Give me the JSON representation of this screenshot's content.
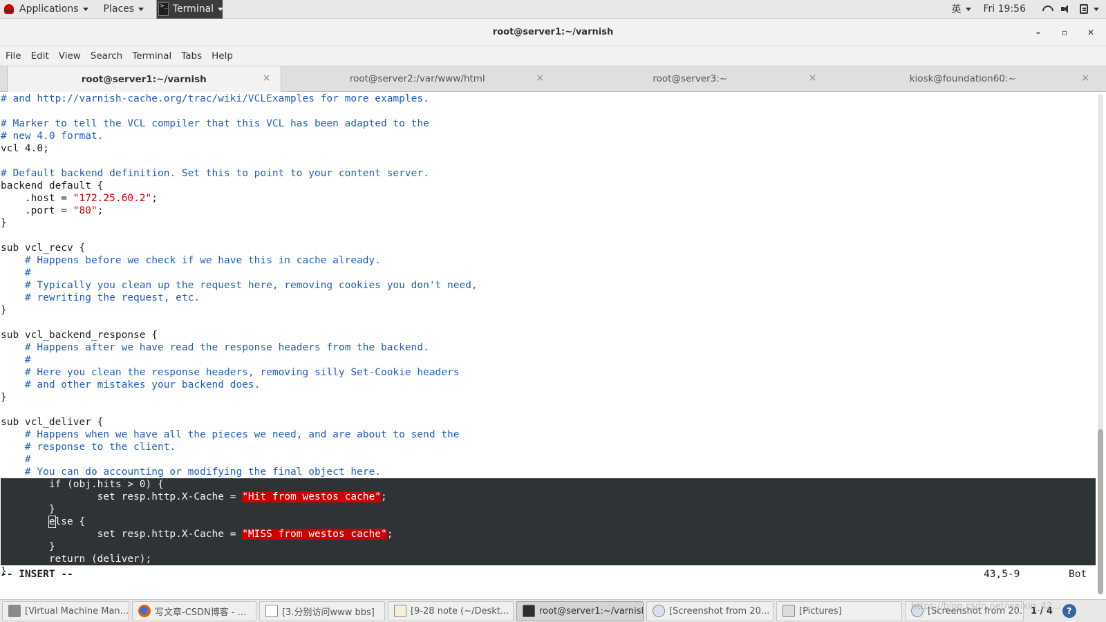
{
  "top_panel": {
    "applications_label": "Applications",
    "places_label": "Places",
    "terminal_label": "Terminal",
    "input_method": "英",
    "clock": "Fri 19:56"
  },
  "window": {
    "title": "root@server1:~/varnish",
    "minimize": "–",
    "maximize": "▫",
    "close": "✕"
  },
  "menu": [
    "File",
    "Edit",
    "View",
    "Search",
    "Terminal",
    "Tabs",
    "Help"
  ],
  "tabs": [
    {
      "label": "root@server1:~/varnish",
      "active": true
    },
    {
      "label": "root@server2:/var/www/html",
      "active": false
    },
    {
      "label": "root@server3:~",
      "active": false
    },
    {
      "label": "kiosk@foundation60:~",
      "active": false
    }
  ],
  "tab_close_glyph": "×",
  "code_lines": [
    {
      "segs": [
        [
          "c",
          "# and http://varnish-cache.org/trac/wiki/VCLExamples for more examples."
        ]
      ]
    },
    {
      "segs": []
    },
    {
      "segs": [
        [
          "c",
          "# Marker to tell the VCL compiler that this VCL has been adapted to the"
        ]
      ]
    },
    {
      "segs": [
        [
          "c",
          "# new 4.0 format."
        ]
      ]
    },
    {
      "segs": [
        [
          "n",
          "vcl 4.0;"
        ]
      ]
    },
    {
      "segs": []
    },
    {
      "segs": [
        [
          "c",
          "# Default backend definition. Set this to point to your content server."
        ]
      ]
    },
    {
      "segs": [
        [
          "n",
          "backend default {"
        ]
      ]
    },
    {
      "segs": [
        [
          "n",
          "    .host = "
        ],
        [
          "s",
          "\"172.25.60.2\""
        ],
        [
          "n",
          ";"
        ]
      ]
    },
    {
      "segs": [
        [
          "n",
          "    .port = "
        ],
        [
          "s",
          "\"80\""
        ],
        [
          "n",
          ";"
        ]
      ]
    },
    {
      "segs": [
        [
          "n",
          "}"
        ]
      ]
    },
    {
      "segs": []
    },
    {
      "segs": [
        [
          "n",
          "sub vcl_recv {"
        ]
      ]
    },
    {
      "segs": [
        [
          "n",
          "    "
        ],
        [
          "c",
          "# Happens before we check if we have this in cache already."
        ]
      ]
    },
    {
      "segs": [
        [
          "n",
          "    "
        ],
        [
          "c",
          "#"
        ]
      ]
    },
    {
      "segs": [
        [
          "n",
          "    "
        ],
        [
          "c",
          "# Typically you clean up the request here, removing cookies you don't need,"
        ]
      ]
    },
    {
      "segs": [
        [
          "n",
          "    "
        ],
        [
          "c",
          "# rewriting the request, etc."
        ]
      ]
    },
    {
      "segs": [
        [
          "n",
          "}"
        ]
      ]
    },
    {
      "segs": []
    },
    {
      "segs": [
        [
          "n",
          "sub vcl_backend_response {"
        ]
      ]
    },
    {
      "segs": [
        [
          "n",
          "    "
        ],
        [
          "c",
          "# Happens after we have read the response headers from the backend."
        ]
      ]
    },
    {
      "segs": [
        [
          "n",
          "    "
        ],
        [
          "c",
          "#"
        ]
      ]
    },
    {
      "segs": [
        [
          "n",
          "    "
        ],
        [
          "c",
          "# Here you clean the response headers, removing silly Set-Cookie headers"
        ]
      ]
    },
    {
      "segs": [
        [
          "n",
          "    "
        ],
        [
          "c",
          "# and other mistakes your backend does."
        ]
      ]
    },
    {
      "segs": [
        [
          "n",
          "}"
        ]
      ]
    },
    {
      "segs": []
    },
    {
      "segs": [
        [
          "n",
          "sub vcl_deliver {"
        ]
      ]
    },
    {
      "segs": [
        [
          "n",
          "    "
        ],
        [
          "c",
          "# Happens when we have all the pieces we need, and are about to send the"
        ]
      ]
    },
    {
      "segs": [
        [
          "n",
          "    "
        ],
        [
          "c",
          "# response to the client."
        ]
      ]
    },
    {
      "segs": [
        [
          "n",
          "    "
        ],
        [
          "c",
          "#"
        ]
      ]
    },
    {
      "segs": [
        [
          "n",
          "    "
        ],
        [
          "c",
          "# You can do accounting or modifying the final object here."
        ]
      ]
    },
    {
      "hl": true,
      "segs": [
        [
          "n",
          "        if (obj.hits > 0) {"
        ]
      ]
    },
    {
      "hl": true,
      "segs": [
        [
          "n",
          "                set resp.http.X-Cache = "
        ],
        [
          "sb",
          "\"Hit from westos cache\""
        ],
        [
          "n",
          ";"
        ]
      ]
    },
    {
      "hl": true,
      "segs": [
        [
          "n",
          "        }"
        ]
      ]
    },
    {
      "hl": true,
      "segs": [
        [
          "n",
          "        "
        ],
        [
          "cur",
          "e"
        ],
        [
          "n",
          "lse {"
        ]
      ]
    },
    {
      "hl": true,
      "segs": [
        [
          "n",
          "                set resp.http.X-Cache = "
        ],
        [
          "sb",
          "\"MISS from westos cache\""
        ],
        [
          "n",
          ";"
        ]
      ]
    },
    {
      "hl": true,
      "segs": [
        [
          "n",
          "        }"
        ]
      ]
    },
    {
      "hl": true,
      "segs": [
        [
          "n",
          "        return (deliver);"
        ]
      ]
    },
    {
      "segs": [
        [
          "n",
          "}"
        ]
      ]
    }
  ],
  "status": {
    "mode": "-- INSERT --",
    "position": "43,5-9",
    "scroll": "Bot"
  },
  "scroll_fraction": 0.33,
  "taskbar": [
    {
      "label": "[Virtual Machine Man...",
      "icon": "vm-icon",
      "active": false
    },
    {
      "label": "写文章-CSDN博客 - ...",
      "icon": "firefox-icon",
      "active": false
    },
    {
      "label": "[3.分别访问www bbs]",
      "icon": "document-icon",
      "active": false
    },
    {
      "label": "[9-28 note (~/Deskt...",
      "icon": "text-editor-icon",
      "active": false
    },
    {
      "label": "root@server1:~/varnish",
      "icon": "terminal-icon",
      "active": true
    },
    {
      "label": "[Screenshot from 20...",
      "icon": "screenshot-icon",
      "active": false
    },
    {
      "label": "[Pictures]",
      "icon": "folder-icon",
      "active": false
    },
    {
      "label": "[Screenshot from 20...",
      "icon": "screenshot-icon",
      "active": false
    }
  ],
  "workspace_pager": "1 / 4",
  "watermark": "https://blog.csdn.net/weixin_42...",
  "colors": {
    "comment": "#1f5fbf",
    "string": "#cc0000",
    "highlight_bg": "#2e3436"
  }
}
